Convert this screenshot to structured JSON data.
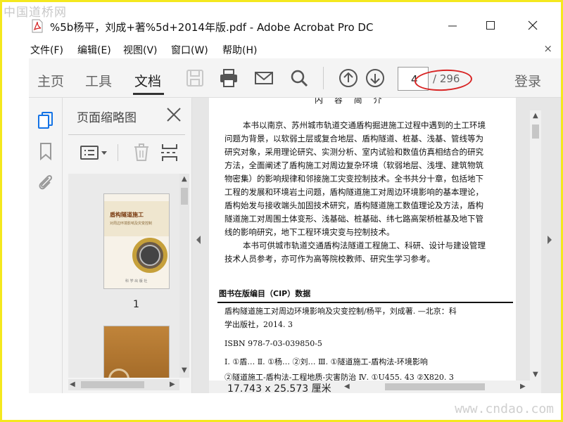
{
  "watermark_top": "中国道桥网",
  "watermark_bottom": "www.cndao.com",
  "window": {
    "title": "%5b杨平，刘成+著%5d+2014年版.pdf - Adobe Acrobat Pro DC",
    "min_label": "—",
    "max_label": "☐",
    "close_label": "✕"
  },
  "menu": {
    "items": [
      "文件(F)",
      "编辑(E)",
      "视图(V)",
      "窗口(W)",
      "帮助(H)"
    ],
    "close_label": "×"
  },
  "toolbar": {
    "tabs": [
      "主页",
      "工具",
      "文档"
    ],
    "active_tab": "文档",
    "page_current": "4",
    "page_total": "/ 296",
    "login": "登录",
    "icons": [
      "save-icon",
      "print-icon",
      "email-icon",
      "search-icon",
      "page-up-icon",
      "page-down-icon"
    ]
  },
  "thumbnails_panel": {
    "title": "页面缩略图",
    "thumb1_title": "盾构隧道施工",
    "thumb1_sub": "对周边环境影响及灾变控制",
    "thumb1_publisher": "科 学 出 版 社",
    "thumb1_label": "1"
  },
  "document": {
    "size": "17.743 x 25.573 厘米",
    "heading": "内 容 简 介",
    "para1": [
      "本书以南京、苏州城市轨道交通盾构掘进施工过程中遇到的土工环境",
      "问题为背景，以软弱土层或复合地层、盾构隧道、桩基、浅基、管线等为",
      "研究对象，采用理论研究、实测分析、室内试验和数值仿真相结合的研究",
      "方法，全面阐述了盾构施工对周边复杂环境（软弱地层、浅埋、建筑物筑",
      "物密集）的影响规律和邻接施工灾变控制技术。全书共分十章，包括地下",
      "工程的发展和环境岩土问题，盾构隧道施工对周边环境影响的基本理论，",
      "盾构始发与接收端头加固技术研究，盾构隧道施工数值理论及方法，盾构",
      "隧道施工对周围土体变形、浅基础、桩基础、纬七路高架桥桩基及地下管",
      "线的影响研究，地下工程环境灾变与控制技术。"
    ],
    "para2": [
      "本书可供城市轨道交通盾构法隧道工程施工、科研、设计与建设管理",
      "技术人员参考，亦可作为高等院校教师、研究生学习参考。"
    ],
    "cip_title": "图书在版编目（CIP）数据",
    "cip_lines": [
      "盾构隧道施工对周边环境影响及灾变控制/杨平，刘成著. —北京：科",
      "学出版社，2014. 3",
      "ISBN 978-7-03-039850-5",
      "Ⅰ. ①盾…  Ⅱ. ①杨… ②刘…  Ⅲ. ①隧道施工-盾构法-环境影响",
      "②隧道施工-盾构法-工程地质-灾害防治  Ⅳ. ①U455. 43 ②X820. 3"
    ]
  }
}
